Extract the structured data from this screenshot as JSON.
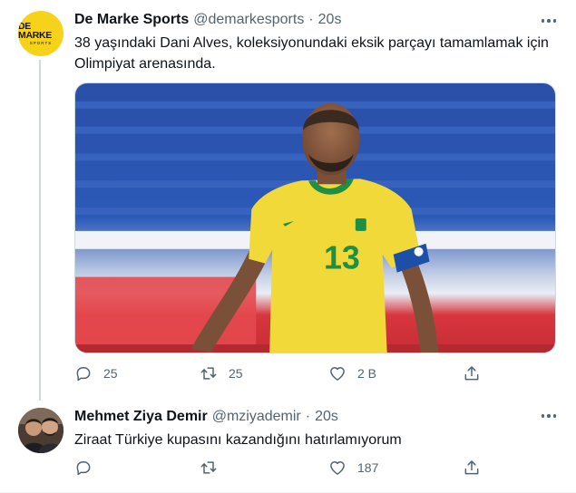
{
  "tweets": [
    {
      "avatar_text": "DE MARKE",
      "avatar_subtext": "SPORTS",
      "name": "De Marke Sports",
      "handle": "@demarkesports",
      "separator": "·",
      "time": "20s",
      "text": "38 yaşındaki Dani Alves, koleksiyonundaki eksik parçayı tamamlamak için Olimpiyat arenasında.",
      "jersey_number": "13",
      "replies": "25",
      "retweets": "25",
      "likes": "2 B"
    },
    {
      "name": "Mehmet Ziya Demir",
      "handle": "@mziyademir",
      "separator": "·",
      "time": "20s",
      "text": "Ziraat Türkiye kupasını kazandığını hatırlamıyorum",
      "replies": "",
      "retweets": "",
      "likes": "187"
    }
  ],
  "icons": [
    "more-icon",
    "reply-icon",
    "retweet-icon",
    "like-icon",
    "share-icon"
  ],
  "colors": {
    "text": "#0f1419",
    "secondary": "#536471",
    "line": "#cfd9de",
    "brand_yellow": "#f7d21b",
    "jersey_yellow": "#f2d93a",
    "jersey_green": "#1f8f44"
  }
}
